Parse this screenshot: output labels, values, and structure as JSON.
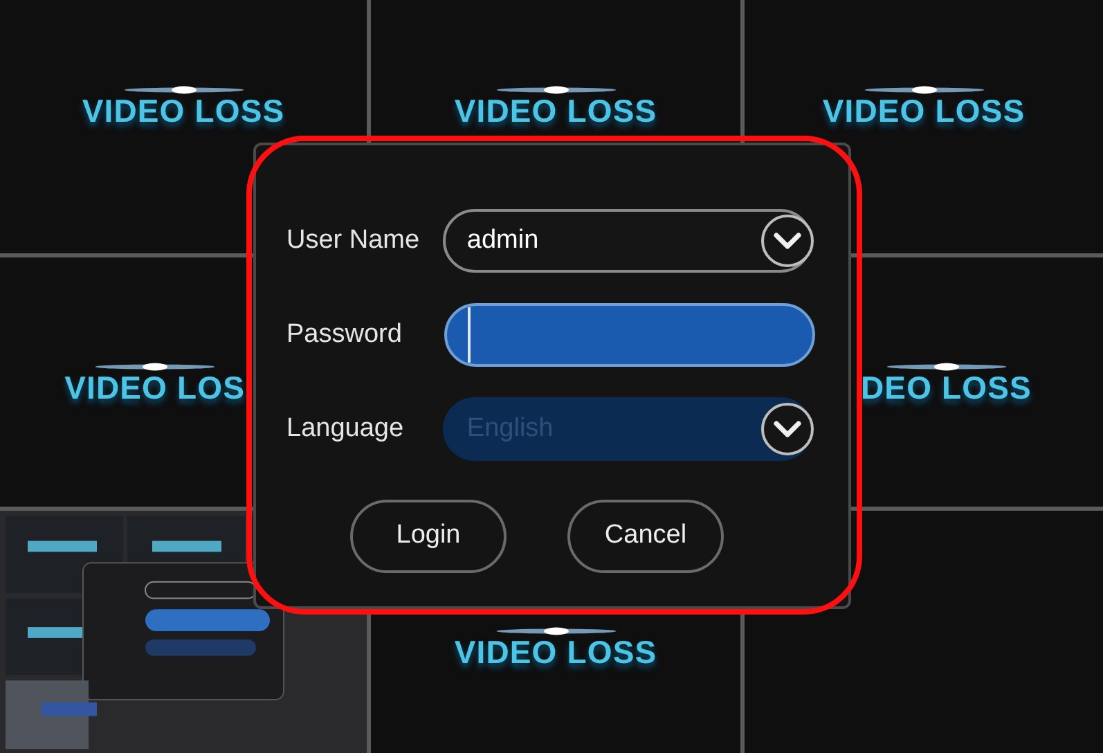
{
  "tiles": [
    {
      "kind": "video_loss",
      "text": "VIDEO LOSS"
    },
    {
      "kind": "video_loss",
      "text": "VIDEO LOSS"
    },
    {
      "kind": "video_loss",
      "text": "VIDEO LOSS"
    },
    {
      "kind": "video_loss",
      "text": "VIDEO LOS"
    },
    {
      "kind": "video_loss",
      "text": "DEO LOSS"
    },
    {
      "kind": "picture"
    },
    {
      "kind": "video_loss",
      "text": "VIDEO LOSS"
    },
    {
      "kind": "empty"
    }
  ],
  "dialog": {
    "fields": [
      {
        "kind": "dropdown",
        "label": "User Name",
        "value": "admin",
        "focused": false,
        "highlighted": false
      },
      {
        "kind": "password",
        "label": "Password",
        "focused": true,
        "highlighted": false
      },
      {
        "kind": "dropdown",
        "label": "Language",
        "value": "English",
        "focused": false,
        "highlighted": true
      }
    ],
    "buttons": [
      "Login",
      "Cancel"
    ]
  }
}
